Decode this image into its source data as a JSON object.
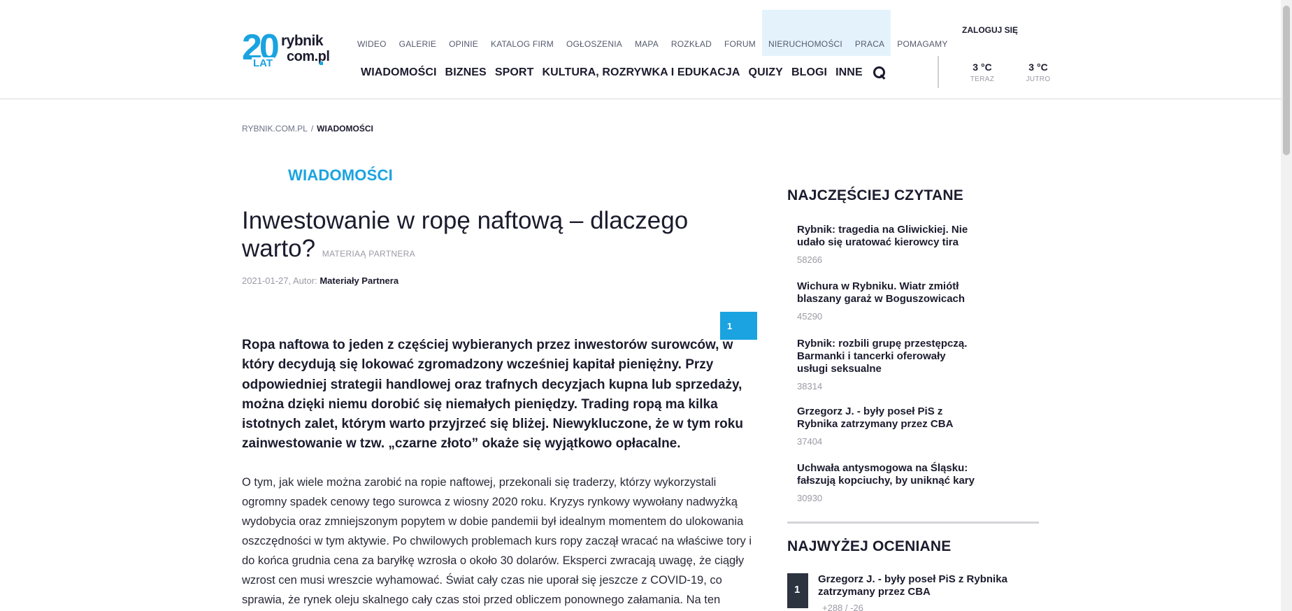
{
  "logo": {
    "big": "20",
    "lat": "LAT",
    "r1": "rybnik",
    "r2": "com.pl"
  },
  "top_nav": [
    {
      "label": "WIDEO",
      "highlight": false
    },
    {
      "label": "GALERIE",
      "highlight": false
    },
    {
      "label": "OPINIE",
      "highlight": false
    },
    {
      "label": "KATALOG FIRM",
      "highlight": false
    },
    {
      "label": "OGŁOSZENIA",
      "highlight": false
    },
    {
      "label": "MAPA",
      "highlight": false
    },
    {
      "label": "ROZKŁAD",
      "highlight": false
    },
    {
      "label": "FORUM",
      "highlight": false
    },
    {
      "label": "NIERUCHOMOŚCI",
      "highlight": true
    },
    {
      "label": "PRACA",
      "highlight": true
    },
    {
      "label": "POMAGAMY",
      "highlight": false
    }
  ],
  "main_nav": [
    "WIADOMOŚCI",
    "BIZNES",
    "SPORT",
    "KULTURA, ROZRYWKA I EDUKACJA",
    "QUIZY",
    "BLOGI",
    "INNE"
  ],
  "login_label": "ZALOGUJ SIĘ",
  "weather": {
    "now": {
      "temp": "3 °C",
      "label": "TERAZ"
    },
    "tomorrow": {
      "temp": "3 °C",
      "label": "JUTRO"
    }
  },
  "breadcrumb": {
    "home": "RYBNIK.COM.PL",
    "separator": "/",
    "current": "WIADOMOŚCI"
  },
  "article": {
    "section": "WIADOMOŚCI",
    "title": "Inwestowanie w ropę naftową – dlaczego warto?",
    "sponsor_tag": "MATERIAĄ PARTNERA",
    "date": "2021-01-27",
    "author_prefix": "Autor:",
    "author": "Materiały Partnera",
    "page_badge": "1",
    "lead": "Ropa naftowa to jeden z częściej wybieranych przez inwestorów surowców, w który decydują się lokować zgromadzony wcześniej kapitał pieniężny. Przy odpowiedniej strategii handlowej oraz trafnych decyzjach kupna lub sprzedaży, można dzięki niemu dorobić się niemałych pieniędzy. Trading ropą ma kilka istotnych zalet, którym warto przyjrzeć się bliżej. Niewykluczone, że w tym roku zainwestowanie w tzw. „czarne złoto” okaże się wyjątkowo opłacalne.",
    "body": "O tym, jak wiele można zarobić na ropie naftowej, przekonali się traderzy, którzy wykorzystali ogromny spadek cenowy tego surowca z wiosny 2020 roku. Kryzys rynkowy wywołany nadwyżką wydobycia oraz zmniejszonym popytem w dobie pandemii był idealnym momentem do ulokowania oszczędności w tym aktywie. Po chwilowych problemach kurs ropy zaczął wracać na właściwe tory i do końca grudnia cena za baryłkę wzrosła o około 30 dolarów. Eksperci zwracają uwagę, że ciągły wzrost cen musi wreszcie wyhamować. Świat cały czas nie uporał się jeszcze z COVID-19, co sprawia, że rynek oleju skalnego cały czas stoi przed obliczem ponownego załamania. Na ten moment czeka"
  },
  "sidebar": {
    "most_read_title": "NAJCZĘŚCIEJ CZYTANE",
    "most_read": [
      {
        "title": "Rybnik: tragedia na Gliwickiej. Nie udało się uratować kierowcy tira",
        "views": "58266"
      },
      {
        "title": "Wichura w Rybniku. Wiatr zmiótł blaszany garaż w Boguszowicach",
        "views": "45290"
      },
      {
        "title": "Rybnik: rozbili grupę przestępczą. Barmanki i tancerki oferowały usługi seksualne",
        "views": "38314"
      },
      {
        "title": "Grzegorz J. - były poseł PiS z Rybnika zatrzymany przez CBA",
        "views": "37404"
      },
      {
        "title": "Uchwała antysmogowa na Śląsku: fałszują kopciuchy, by uniknąć kary",
        "views": "30930"
      }
    ],
    "top_rated_title": "NAJWYŻEJ OCENIANE",
    "top_rated": [
      {
        "rank": "1",
        "title": "Grzegorz J. - były poseł PiS z Rybnika zatrzymany przez CBA",
        "votes": "+288 / -26"
      }
    ]
  },
  "colors": {
    "accent": "#1aa3e0",
    "text": "#1b1b2e",
    "muted": "#9a9aa5",
    "highlight_bg": "#e4f3fb"
  }
}
